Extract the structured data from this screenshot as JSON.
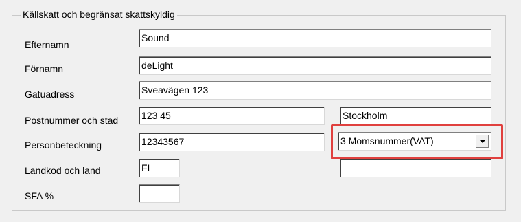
{
  "group": {
    "title": "Källskatt och begränsat skattskyldig"
  },
  "labels": {
    "efternamn": "Efternamn",
    "fornamn": "Förnamn",
    "gatuadress": "Gatuadress",
    "postnummer": "Postnummer och stad",
    "personbeteckning": "Personbeteckning",
    "landkod": "Landkod och land",
    "sfa": "SFA %"
  },
  "fields": {
    "efternamn": "Sound",
    "fornamn": "deLight",
    "gatuadress": "Sveavägen 123",
    "postnummer": "123 45",
    "stad": "Stockholm",
    "personbeteckning": "12343567",
    "id_type": "3 Momsnummer(VAT)",
    "landkod": "FI",
    "land": "",
    "sfa": ""
  },
  "colors": {
    "highlight": "#e0403e",
    "window_bg": "#f0f0f0"
  },
  "icons": {
    "dropdown": "chevron-down-icon"
  }
}
